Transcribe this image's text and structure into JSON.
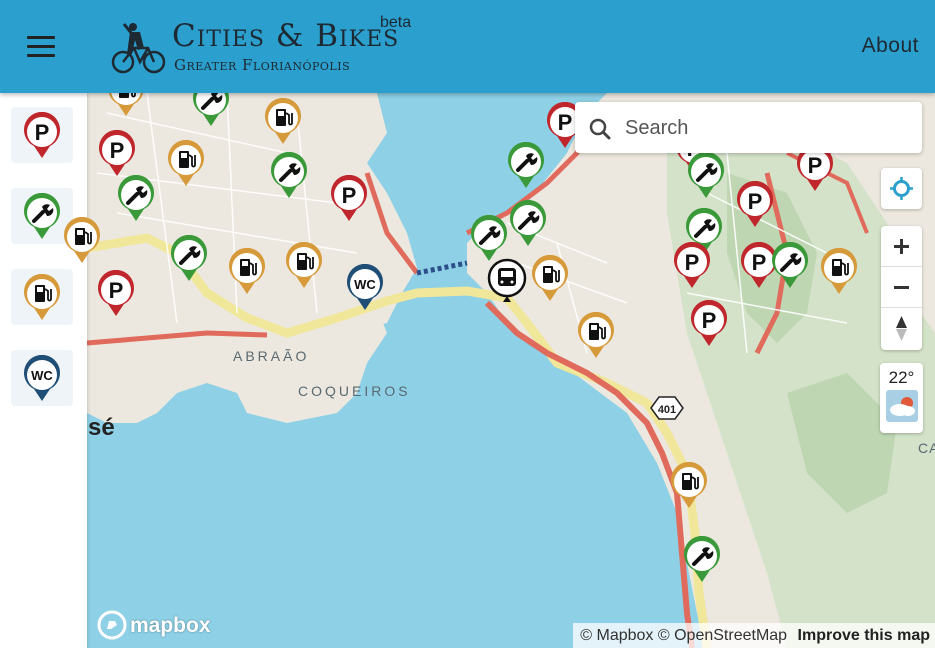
{
  "header": {
    "title": "Cities & Bikes",
    "beta": "beta",
    "subtitle": "Greater Florianópolis",
    "about_label": "About",
    "menu_icon": "hamburger-menu-icon",
    "logo_icon": "cyclist-logo-icon",
    "background": "#2b9fcd"
  },
  "sidebar": {
    "filters": [
      {
        "type": "parking",
        "glyph": "P",
        "color": "#c0272d",
        "icon": "parking-pin-icon"
      },
      {
        "type": "repair",
        "glyph": "wrench",
        "color": "#3a9a3a",
        "icon": "wrench-pin-icon"
      },
      {
        "type": "fuel",
        "glyph": "fuel",
        "color": "#d69a3a",
        "icon": "fuel-pin-icon"
      },
      {
        "type": "restroom",
        "glyph": "WC",
        "color": "#1f4f77",
        "icon": "wc-pin-icon"
      }
    ]
  },
  "search": {
    "placeholder": "Search",
    "icon": "search-icon"
  },
  "controls": {
    "locate_icon": "locate-icon",
    "zoom_in_icon": "zoom-in-icon",
    "zoom_out_icon": "zoom-out-icon",
    "compass_icon": "compass-icon"
  },
  "weather": {
    "temperature": "22°",
    "icon": "cloud-sun-icon"
  },
  "map": {
    "labels": {
      "abraao": "ABRAÃO",
      "coqueiros": "COQUEIROS",
      "partial_city": "sé",
      "partial_ca": "CA"
    },
    "road_shield": "401",
    "mapbox_logo": "mapbox",
    "attribution": {
      "mapbox": "© Mapbox",
      "osm": "© OpenStreetMap",
      "improve": "Improve this map"
    }
  }
}
